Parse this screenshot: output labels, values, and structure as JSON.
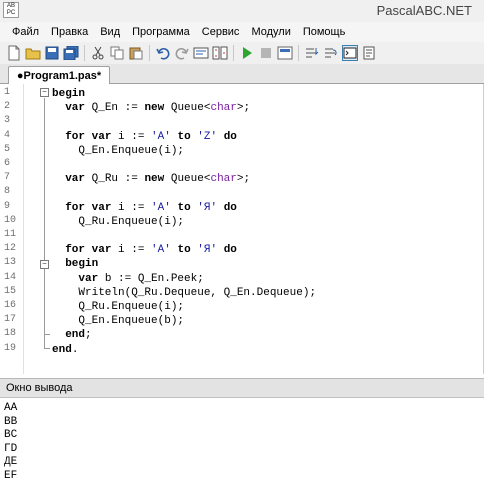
{
  "window": {
    "title": "PascalABC.NET",
    "icon_text": "AB\nPC"
  },
  "menu": [
    "Файл",
    "Правка",
    "Вид",
    "Программа",
    "Сервис",
    "Модули",
    "Помощь"
  ],
  "toolbar": {
    "icons": [
      "new-file-icon",
      "open-folder-icon",
      "save-icon",
      "save-all-icon",
      "cut-icon",
      "copy-icon",
      "paste-icon",
      "undo-icon",
      "redo-icon",
      "refactor-icon",
      "compare-icon",
      "run-icon",
      "stop-icon",
      "debug-icon",
      "step-into-icon",
      "step-over-icon",
      "output-window-icon",
      "properties-icon"
    ]
  },
  "tabs": [
    {
      "label": "●Program1.pas*"
    }
  ],
  "editor": {
    "line_numbers": [
      "1",
      "2",
      "3",
      "4",
      "5",
      "6",
      "7",
      "8",
      "9",
      "10",
      "11",
      "12",
      "13",
      "14",
      "15",
      "16",
      "17",
      "18",
      "19"
    ],
    "lines": [
      [
        {
          "t": "begin",
          "k": "kw"
        }
      ],
      [
        {
          "t": "  "
        },
        {
          "t": "var",
          "k": "kw"
        },
        {
          "t": " Q_En := "
        },
        {
          "t": "new",
          "k": "kw"
        },
        {
          "t": " Queue<"
        },
        {
          "t": "char",
          "k": "typ"
        },
        {
          "t": ">;"
        }
      ],
      [],
      [
        {
          "t": "  "
        },
        {
          "t": "for",
          "k": "kw"
        },
        {
          "t": " "
        },
        {
          "t": "var",
          "k": "kw"
        },
        {
          "t": " i := "
        },
        {
          "t": "'A'",
          "k": "str"
        },
        {
          "t": " "
        },
        {
          "t": "to",
          "k": "kw"
        },
        {
          "t": " "
        },
        {
          "t": "'Z'",
          "k": "str"
        },
        {
          "t": " "
        },
        {
          "t": "do",
          "k": "kw"
        }
      ],
      [
        {
          "t": "    Q_En.Enqueue(i);"
        }
      ],
      [],
      [
        {
          "t": "  "
        },
        {
          "t": "var",
          "k": "kw"
        },
        {
          "t": " Q_Ru := "
        },
        {
          "t": "new",
          "k": "kw"
        },
        {
          "t": " Queue<"
        },
        {
          "t": "char",
          "k": "typ"
        },
        {
          "t": ">;"
        }
      ],
      [],
      [
        {
          "t": "  "
        },
        {
          "t": "for",
          "k": "kw"
        },
        {
          "t": " "
        },
        {
          "t": "var",
          "k": "kw"
        },
        {
          "t": " i := "
        },
        {
          "t": "'A'",
          "k": "str"
        },
        {
          "t": " "
        },
        {
          "t": "to",
          "k": "kw"
        },
        {
          "t": " "
        },
        {
          "t": "'Я'",
          "k": "str"
        },
        {
          "t": " "
        },
        {
          "t": "do",
          "k": "kw"
        }
      ],
      [
        {
          "t": "    Q_Ru.Enqueue(i);"
        }
      ],
      [],
      [
        {
          "t": "  "
        },
        {
          "t": "for",
          "k": "kw"
        },
        {
          "t": " "
        },
        {
          "t": "var",
          "k": "kw"
        },
        {
          "t": " i := "
        },
        {
          "t": "'A'",
          "k": "str"
        },
        {
          "t": " "
        },
        {
          "t": "to",
          "k": "kw"
        },
        {
          "t": " "
        },
        {
          "t": "'Я'",
          "k": "str"
        },
        {
          "t": " "
        },
        {
          "t": "do",
          "k": "kw"
        }
      ],
      [
        {
          "t": "  "
        },
        {
          "t": "begin",
          "k": "kw"
        }
      ],
      [
        {
          "t": "    "
        },
        {
          "t": "var",
          "k": "kw"
        },
        {
          "t": " b := Q_En.Peek;"
        }
      ],
      [
        {
          "t": "    Writeln(Q_Ru.Dequeue, Q_En.Dequeue);"
        }
      ],
      [
        {
          "t": "    Q_Ru.Enqueue(i);"
        }
      ],
      [
        {
          "t": "    Q_En.Enqueue(b);"
        }
      ],
      [
        {
          "t": "  "
        },
        {
          "t": "end",
          "k": "kw"
        },
        {
          "t": ";"
        }
      ],
      [
        {
          "t": "end",
          "k": "kw"
        },
        {
          "t": "."
        }
      ]
    ]
  },
  "output": {
    "title": "Окно вывода",
    "lines": [
      "AA",
      "BB",
      "BC",
      "ГD",
      "ДE",
      "EF"
    ]
  },
  "colors": {
    "keyword": "#000000",
    "string": "#1a1aa6",
    "type": "#7a1fa0",
    "accent": "#3c7fb1"
  }
}
